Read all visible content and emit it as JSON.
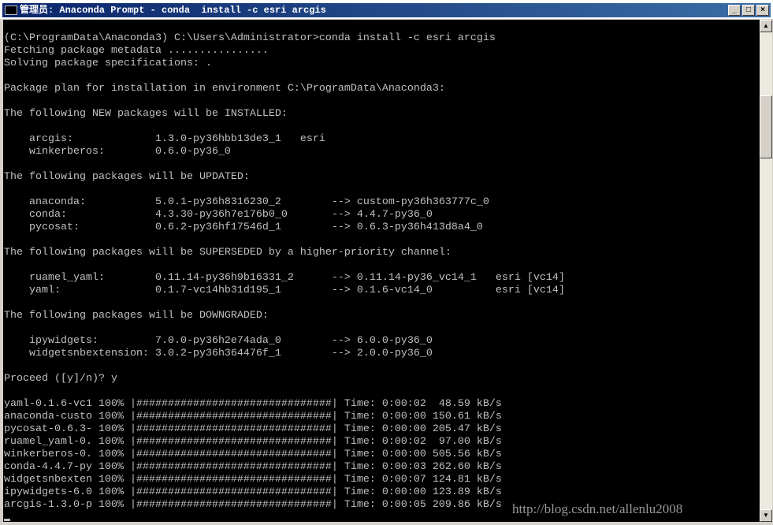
{
  "window": {
    "title": "管理员: Anaconda Prompt - conda  install -c esri arcgis",
    "minimize": "_",
    "maximize": "□",
    "close": "×"
  },
  "console": {
    "lines": [
      "",
      "(C:\\ProgramData\\Anaconda3) C:\\Users\\Administrator>conda install -c esri arcgis",
      "Fetching package metadata ................",
      "Solving package specifications: .",
      "",
      "Package plan for installation in environment C:\\ProgramData\\Anaconda3:",
      "",
      "The following NEW packages will be INSTALLED:",
      "",
      "    arcgis:             1.3.0-py36hbb13de3_1   esri",
      "    winkerberos:        0.6.0-py36_0",
      "",
      "The following packages will be UPDATED:",
      "",
      "    anaconda:           5.0.1-py36h8316230_2        --> custom-py36h363777c_0",
      "    conda:              4.3.30-py36h7e176b0_0       --> 4.4.7-py36_0",
      "    pycosat:            0.6.2-py36hf17546d_1        --> 0.6.3-py36h413d8a4_0",
      "",
      "The following packages will be SUPERSEDED by a higher-priority channel:",
      "",
      "    ruamel_yaml:        0.11.14-py36h9b16331_2      --> 0.11.14-py36_vc14_1   esri [vc14]",
      "    yaml:               0.1.7-vc14hb31d195_1        --> 0.1.6-vc14_0          esri [vc14]",
      "",
      "The following packages will be DOWNGRADED:",
      "",
      "    ipywidgets:         7.0.0-py36h2e74ada_0        --> 6.0.0-py36_0",
      "    widgetsnbextension: 3.0.2-py36h364476f_1        --> 2.0.0-py36_0",
      "",
      "Proceed ([y]/n)? y",
      "",
      "yaml-0.1.6-vc1 100% |###############################| Time: 0:00:02  48.59 kB/s",
      "anaconda-custo 100% |###############################| Time: 0:00:00 150.61 kB/s",
      "pycosat-0.6.3- 100% |###############################| Time: 0:00:00 205.47 kB/s",
      "ruamel_yaml-0. 100% |###############################| Time: 0:00:02  97.00 kB/s",
      "winkerberos-0. 100% |###############################| Time: 0:00:00 505.56 kB/s",
      "conda-4.4.7-py 100% |###############################| Time: 0:00:03 262.60 kB/s",
      "widgetsnbexten 100% |###############################| Time: 0:00:07 124.81 kB/s",
      "ipywidgets-6.0 100% |###############################| Time: 0:00:00 123.89 kB/s",
      "arcgis-1.3.0-p 100% |###############################| Time: 0:00:05 209.86 kB/s"
    ]
  },
  "watermark": "http://blog.csdn.net/allenlu2008",
  "scrollbar": {
    "up": "▲",
    "down": "▼"
  }
}
